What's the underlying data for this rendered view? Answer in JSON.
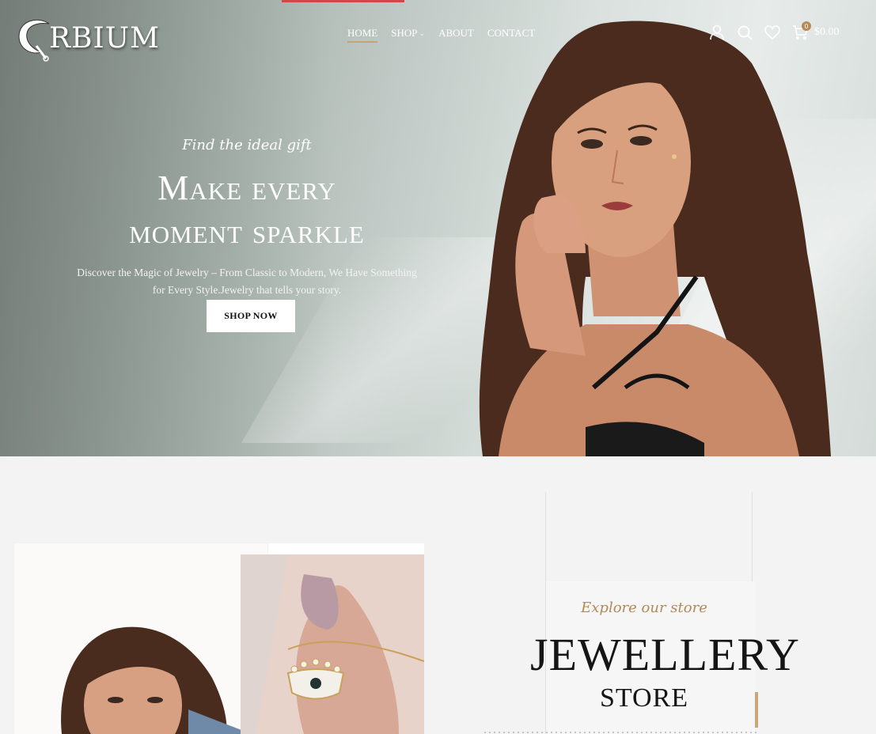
{
  "brand": {
    "name": "RBIUM",
    "full_name": "ORBIUM"
  },
  "nav": {
    "items": [
      {
        "label": "HOME",
        "active": true
      },
      {
        "label": "SHOP",
        "has_dropdown": true
      },
      {
        "label": "ABOUT"
      },
      {
        "label": "CONTACT"
      }
    ]
  },
  "header_tools": {
    "account_icon": "user-icon",
    "search_icon": "search-icon",
    "wishlist_icon": "heart-icon",
    "cart_icon": "cart-icon",
    "cart_count": "0",
    "cart_total": "$0.00"
  },
  "hero": {
    "eyebrow": "Find the ideal gift",
    "title_line1": "Make every",
    "title_line2": "moment sparkle",
    "subtitle_line1": "Discover the Magic of Jewelry – From Classic to Modern, We Have Something",
    "subtitle_line2": "for Every Style.Jewelry that tells your story.",
    "cta_label": "SHOP NOW"
  },
  "store": {
    "eyebrow": "Explore our store",
    "title": "JEWELLERY",
    "subtitle": "STORE"
  },
  "colors": {
    "accent_gold": "#c8a36f",
    "top_accent": "#d64545",
    "store_eyebrow": "#b08a57",
    "page_bg": "#f3f3f3"
  }
}
